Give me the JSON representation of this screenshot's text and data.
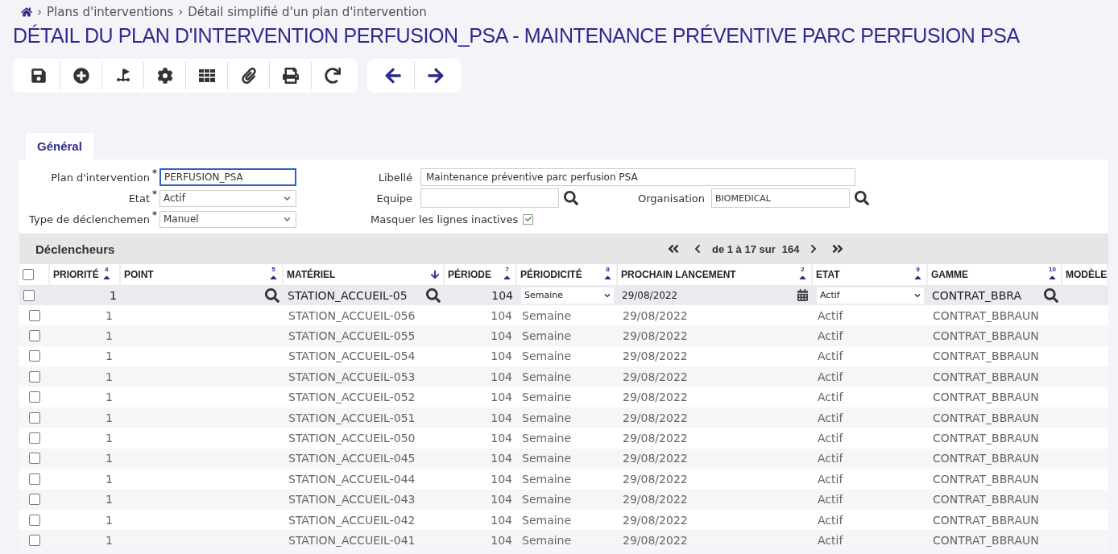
{
  "breadcrumb": [
    "Plans d'interventions",
    "Détail simplifié d'un plan d'intervention"
  ],
  "breadcrumb_separator": "›",
  "title": "DÉTAIL DU PLAN D'INTERVENTION PERFUSION_PSA - MAINTENANCE PRÉVENTIVE PARC PERFUSION PSA",
  "tabs": [
    {
      "label": "Général",
      "selected": true
    }
  ],
  "form": {
    "required_mark": "*",
    "left": [
      {
        "label": "Plan d'intervention",
        "kind": "input",
        "value": "PERFUSION_PSA",
        "focused": true,
        "required": true
      },
      {
        "label": "Etat",
        "kind": "select",
        "value": "Actif",
        "focused": false,
        "required": true
      },
      {
        "label": "Type de déclenchemen",
        "kind": "select",
        "value": "Manuel",
        "focused": false,
        "required": true
      }
    ],
    "libelle": {
      "label": "Libellé",
      "value": "Maintenance préventive parc perfusion PSA"
    },
    "equipe": {
      "label": "Equipe"
    },
    "organisation": {
      "label": "Organisation",
      "value": "BIOMEDICAL"
    },
    "masquer": {
      "label": "Masquer les lignes inactives",
      "checked": true
    }
  },
  "section": {
    "title": "Déclencheurs",
    "pager": "de 1 à 17 sur",
    "total": "164"
  },
  "columns": [
    {
      "label": "PRIORITÉ",
      "sort": "4"
    },
    {
      "label": "POINT",
      "sort": "5"
    },
    {
      "label": "MATÉRIEL",
      "sort_arrow": true
    },
    {
      "label": "PÉRIODE",
      "sort": "7"
    },
    {
      "label": "PÉRIODICITÉ",
      "sort": "8"
    },
    {
      "label": "PROCHAIN LANCEMENT",
      "sort": "2"
    },
    {
      "label": "ETAT",
      "sort": "9"
    },
    {
      "label": "GAMME",
      "sort": "10"
    },
    {
      "label": "MODÈLE"
    }
  ],
  "header_checked": false,
  "filter": {
    "checked": false,
    "priorite": "1",
    "materiel": "STATION_ACCUEIL-05",
    "periode": "104",
    "periodicite": "Semaine",
    "prochain": "29/08/2022",
    "etat": "Actif",
    "gamme": "CONTRAT_BBRA"
  },
  "rows": [
    {
      "checked": false,
      "priorite": "1",
      "materiel": "STATION_ACCUEIL-056",
      "periode": "104",
      "periodicite": "Semaine",
      "prochain": "29/08/2022",
      "etat": "Actif",
      "gamme": "CONTRAT_BBRAUN"
    },
    {
      "checked": false,
      "priorite": "1",
      "materiel": "STATION_ACCUEIL-055",
      "periode": "104",
      "periodicite": "Semaine",
      "prochain": "29/08/2022",
      "etat": "Actif",
      "gamme": "CONTRAT_BBRAUN"
    },
    {
      "checked": false,
      "priorite": "1",
      "materiel": "STATION_ACCUEIL-054",
      "periode": "104",
      "periodicite": "Semaine",
      "prochain": "29/08/2022",
      "etat": "Actif",
      "gamme": "CONTRAT_BBRAUN"
    },
    {
      "checked": false,
      "priorite": "1",
      "materiel": "STATION_ACCUEIL-053",
      "periode": "104",
      "periodicite": "Semaine",
      "prochain": "29/08/2022",
      "etat": "Actif",
      "gamme": "CONTRAT_BBRAUN"
    },
    {
      "checked": false,
      "priorite": "1",
      "materiel": "STATION_ACCUEIL-052",
      "periode": "104",
      "periodicite": "Semaine",
      "prochain": "29/08/2022",
      "etat": "Actif",
      "gamme": "CONTRAT_BBRAUN"
    },
    {
      "checked": false,
      "priorite": "1",
      "materiel": "STATION_ACCUEIL-051",
      "periode": "104",
      "periodicite": "Semaine",
      "prochain": "29/08/2022",
      "etat": "Actif",
      "gamme": "CONTRAT_BBRAUN"
    },
    {
      "checked": false,
      "priorite": "1",
      "materiel": "STATION_ACCUEIL-050",
      "periode": "104",
      "periodicite": "Semaine",
      "prochain": "29/08/2022",
      "etat": "Actif",
      "gamme": "CONTRAT_BBRAUN"
    },
    {
      "checked": false,
      "priorite": "1",
      "materiel": "STATION_ACCUEIL-045",
      "periode": "104",
      "periodicite": "Semaine",
      "prochain": "29/08/2022",
      "etat": "Actif",
      "gamme": "CONTRAT_BBRAUN"
    },
    {
      "checked": false,
      "priorite": "1",
      "materiel": "STATION_ACCUEIL-044",
      "periode": "104",
      "periodicite": "Semaine",
      "prochain": "29/08/2022",
      "etat": "Actif",
      "gamme": "CONTRAT_BBRAUN"
    },
    {
      "checked": false,
      "priorite": "1",
      "materiel": "STATION_ACCUEIL-043",
      "periode": "104",
      "periodicite": "Semaine",
      "prochain": "29/08/2022",
      "etat": "Actif",
      "gamme": "CONTRAT_BBRAUN"
    },
    {
      "checked": false,
      "priorite": "1",
      "materiel": "STATION_ACCUEIL-042",
      "periode": "104",
      "periodicite": "Semaine",
      "prochain": "29/08/2022",
      "etat": "Actif",
      "gamme": "CONTRAT_BBRAUN"
    },
    {
      "checked": false,
      "priorite": "1",
      "materiel": "STATION_ACCUEIL-041",
      "periode": "104",
      "periodicite": "Semaine",
      "prochain": "29/08/2022",
      "etat": "Actif",
      "gamme": "CONTRAT_BBRAUN"
    }
  ]
}
